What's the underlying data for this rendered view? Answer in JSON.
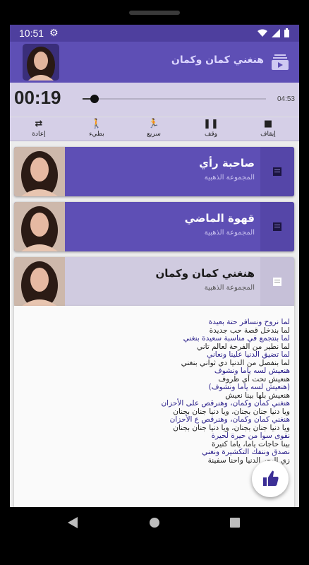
{
  "status": {
    "time": "10:51",
    "icons": [
      "gear-icon",
      "wifi-icon",
      "signal-icon",
      "battery-icon"
    ]
  },
  "toolbar": {
    "title": "هنغني كمان وكمان",
    "playlist_icon": "playlist-play-icon"
  },
  "player": {
    "elapsed": "00:19",
    "duration": "04:53",
    "progress_fraction": 0.065
  },
  "controls": [
    {
      "name": "stop",
      "label": "إيقاف",
      "icon": "stop-icon"
    },
    {
      "name": "pause",
      "label": "وقف",
      "icon": "pause-icon"
    },
    {
      "name": "fast",
      "label": "سريع",
      "icon": "run-icon"
    },
    {
      "name": "slow",
      "label": "بطيء",
      "icon": "walk-icon"
    },
    {
      "name": "repeat",
      "label": "إعادة",
      "icon": "repeat-icon"
    }
  ],
  "songs": [
    {
      "title": "صاحبة رأي",
      "subtitle": "المجموعة الذهبية",
      "expanded": false
    },
    {
      "title": "قهوة الماضي",
      "subtitle": "المجموعة الذهبية",
      "expanded": false
    },
    {
      "title": "هنغني كمان وكمان",
      "subtitle": "المجموعة الذهبية",
      "expanded": true
    }
  ],
  "lyrics": [
    {
      "text": "لما نروح ونسافر حتة بعيدة",
      "color": "#2a1f8a"
    },
    {
      "text": "لما بندخل قصة حب جديدة",
      "color": "#222222"
    },
    {
      "text": "لما بنتجمع في مناسبة سعيدة بنغني",
      "color": "#2a1f8a"
    },
    {
      "text": "لما نطير من الفرحة لعالم تاني",
      "color": "#222222"
    },
    {
      "text": "لما تضيق الدنيا علينا ونعاني",
      "color": "#2a1f8a"
    },
    {
      "text": "لما بنفصل من الدنيا دي ثواني بنغني",
      "color": "#222222"
    },
    {
      "text": "هنعيش لسه ياما ونشوف",
      "color": "#2a1f8a"
    },
    {
      "text": "هنعيش تحت أي ظروف",
      "color": "#222222"
    },
    {
      "text": "(هنعيش لسه ياما ونشوف)",
      "color": "#2a1f8a"
    },
    {
      "text": "هنعيش بلها بينا نعيش",
      "color": "#222222"
    },
    {
      "text": "هنغني كمان وكمان، وهنرقص على الأحزان",
      "color": "#2a1f8a"
    },
    {
      "text": "ويا دنيا جنان بجنان، ويا دنيا جنان بجنان",
      "color": "#222222"
    },
    {
      "text": "هنغني كمان وكمان، وهنرقص ع الأحزان",
      "color": "#2a1f8a"
    },
    {
      "text": "ويا دنيا جنان بجنان، ويا دنيا جنان بجنان",
      "color": "#222222"
    },
    {
      "text": "نقوى سوا من حيرة لحيرة",
      "color": "#2a1f8a"
    },
    {
      "text": "بينا حاجات ياما، ياما كتيرة",
      "color": "#222222"
    },
    {
      "text": "نصدق وننفك التكشيرة ونغني",
      "color": "#2a1f8a"
    },
    {
      "text": "زي البحر الدنيا واحنا سفينة",
      "color": "#222222"
    }
  ],
  "fab_icon": "thumbs-up-icon"
}
